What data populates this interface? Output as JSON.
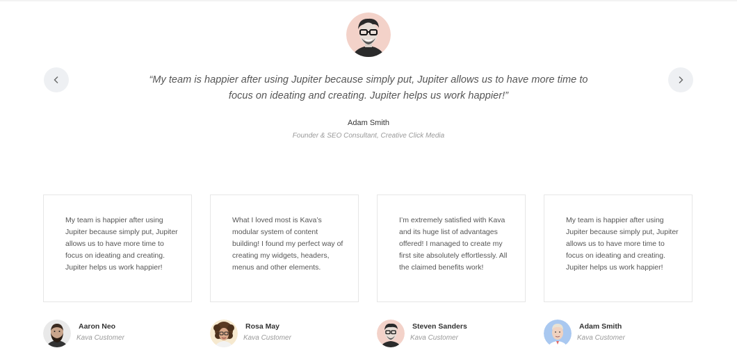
{
  "featured": {
    "quote": "“My team is happier after using Jupiter because simply put, Jupiter allows us to have more time to focus on ideating and creating. Jupiter helps us work happier!”",
    "name": "Adam Smith",
    "role": "Founder & SEO Consultant, Creative Click Media",
    "avatar_icon": "man-glasses-portrait"
  },
  "navigation": {
    "prev_icon": "chevron-left-icon",
    "next_icon": "chevron-right-icon"
  },
  "testimonials": [
    {
      "text": "My team is happier after using Jupiter because simply put, Jupiter allows us to have more time to focus on ideating and creating. Jupiter helps us work happier!",
      "name": "Aaron Neo",
      "role": "Kava Customer",
      "avatar_icon": "bearded-man-portrait"
    },
    {
      "text": "What I loved most is Kava’s modular system of content building! I found my perfect way of creating my widgets, headers, menus and other elements.",
      "name": "Rosa May",
      "role": "Kava Customer",
      "avatar_icon": "curly-hair-woman-portrait"
    },
    {
      "text": "I’m extremely satisfied with Kava and its huge list of advantages offered! I managed to create my first site absolutely effortlessly. All the claimed benefits work!",
      "name": "Steven Sanders",
      "role": "Kava Customer",
      "avatar_icon": "man-glasses-portrait"
    },
    {
      "text": "My team is happier after using Jupiter because simply put, Jupiter allows us to have more time to focus on ideating and creating. Jupiter helps us work happier!",
      "name": "Adam Smith",
      "role": "Kava Customer",
      "avatar_icon": "blonde-man-portrait"
    }
  ],
  "colors": {
    "nav_button_bg": "#eef0f3",
    "card_border": "#e6e6e6",
    "muted_text": "#999999",
    "featured_avatar_bg": "#f3d2c9",
    "blue_avatar_bg": "#a9c8f0"
  }
}
